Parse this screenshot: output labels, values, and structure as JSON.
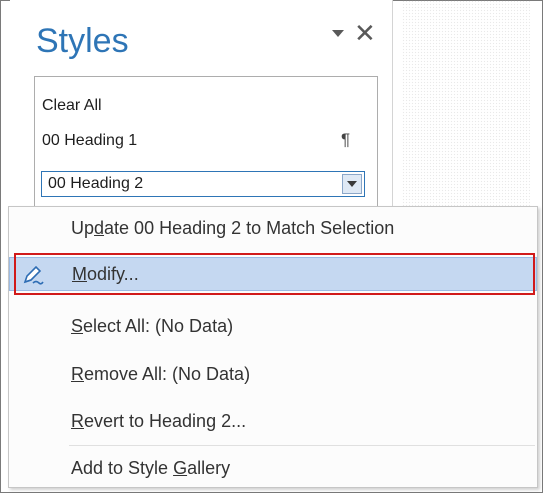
{
  "styles_pane": {
    "title": "Styles",
    "items": [
      {
        "label": "Clear All"
      },
      {
        "label": "00 Heading 1",
        "marker": "¶"
      },
      {
        "label": "00 Heading 2"
      }
    ]
  },
  "context_menu": {
    "items": [
      {
        "pre": "Up",
        "key": "d",
        "post": "ate 00 Heading 2 to Match Selection"
      },
      {
        "pre": "",
        "key": "M",
        "post": "odify..."
      },
      {
        "pre": "",
        "key": "S",
        "post": "elect All: (No Data)"
      },
      {
        "pre": "",
        "key": "R",
        "post": "emove All: (No Data)"
      },
      {
        "pre": "",
        "key": "R",
        "post": "evert to Heading 2..."
      },
      {
        "pre": "Add to Style ",
        "key": "G",
        "post": "allery"
      }
    ]
  },
  "colors": {
    "accent": "#2e75b6",
    "hover": "#c5d8f1",
    "highlight": "#d11a1a"
  },
  "icons": {
    "modify": "pen-style-icon",
    "close": "close-icon",
    "dropdown": "chevron-down-icon",
    "pilcrow": "pilcrow-icon"
  }
}
